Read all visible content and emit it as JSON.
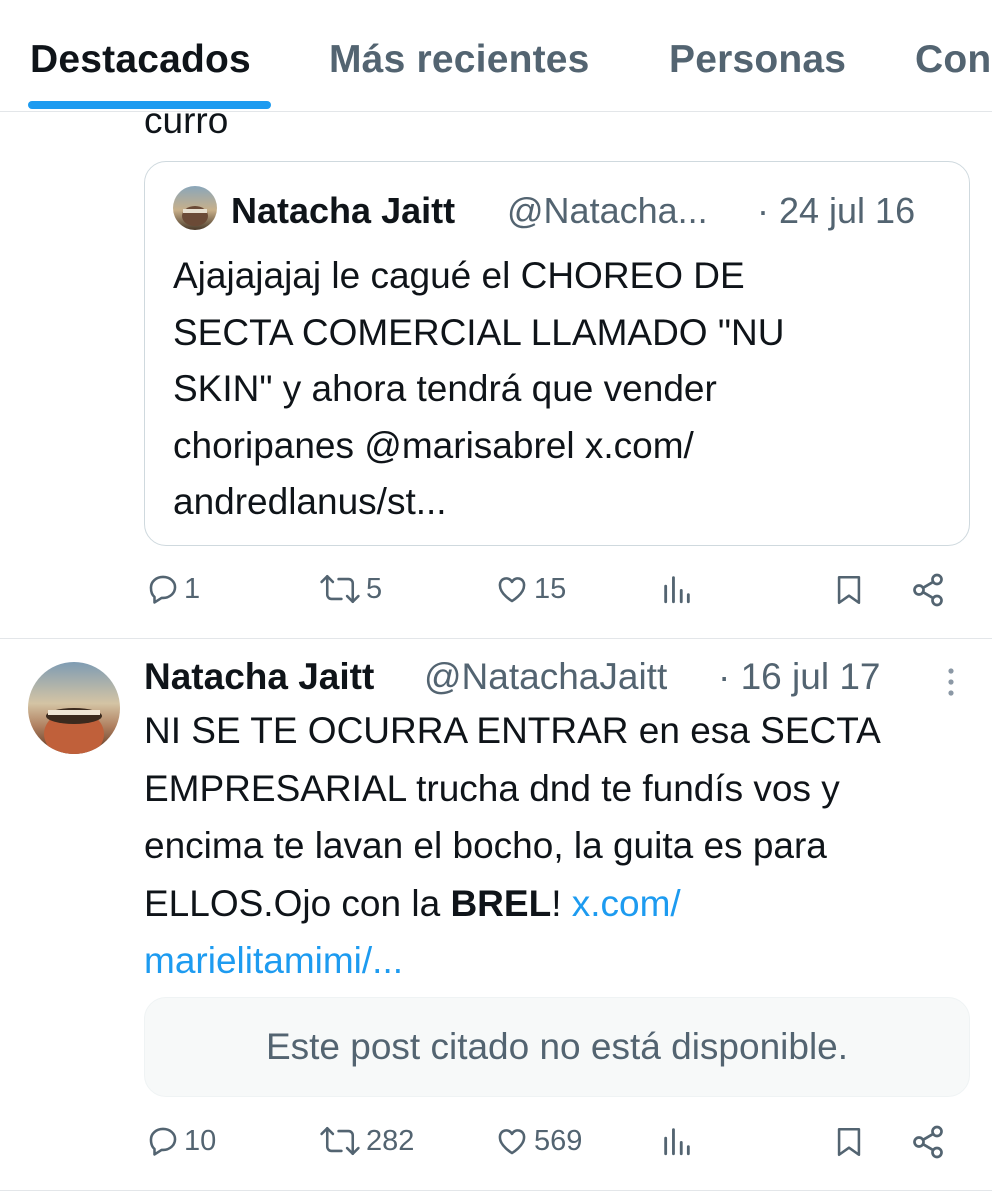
{
  "tabs": [
    {
      "label": "Destacados",
      "active": true
    },
    {
      "label": "Más recientes",
      "active": false
    },
    {
      "label": "Personas",
      "active": false
    },
    {
      "label": "Con",
      "active": false
    }
  ],
  "tweet1": {
    "text_tail": "curro",
    "quote": {
      "name": "Natacha Jaitt",
      "handle": "@Natacha...",
      "date": "· 24 jul 16",
      "text_lines": [
        "Ajajajajaj le cagué el CHOREO DE",
        "SECTA COMERCIAL LLAMADO \"NU",
        "SKIN\" y ahora tendrá que vender",
        "choripanes @marisabrel  x.com/",
        "andredlanus/st..."
      ]
    },
    "actions": {
      "replies": "1",
      "reposts": "5",
      "likes": "15"
    }
  },
  "tweet2": {
    "name": "Natacha Jaitt",
    "handle": "@NatachaJaitt",
    "date": "· 16 jul 17",
    "text_lines": [
      "NI SE TE OCURRA ENTRAR en esa SECTA",
      "EMPRESARIAL trucha dnd te fundís vos y",
      "encima te lavan el bocho, la guita es para"
    ],
    "line4_prefix": "ELLOS.Ojo con la ",
    "line4_bold": "BREL",
    "line4_suffix": "! ",
    "link_part1": "x.com/",
    "link_part2": "marielitamimi/...",
    "unavailable_text": "Este post citado no está disponible.",
    "actions": {
      "replies": "10",
      "reposts": "282",
      "likes": "569"
    }
  },
  "colors": {
    "accent": "#1d9bf0",
    "text": "#0f1419",
    "muted": "#536471",
    "border": "#cfd9de"
  },
  "icons": [
    "reply-icon",
    "repost-icon",
    "like-icon",
    "views-icon",
    "bookmark-icon",
    "share-icon",
    "more-icon"
  ]
}
